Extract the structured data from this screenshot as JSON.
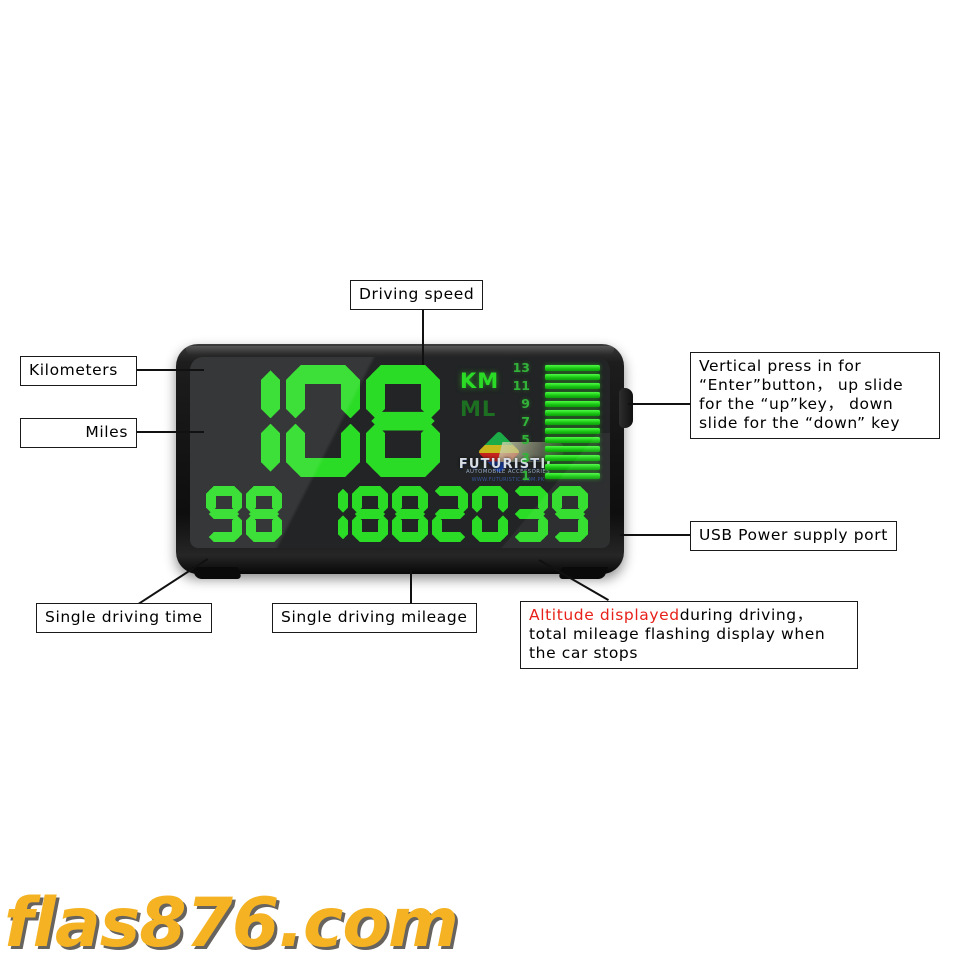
{
  "page": {
    "background": "#ffffff",
    "watermark": "flas876.com",
    "watermark_color": "#f5b324"
  },
  "device": {
    "type": "car-hud-head-up-display",
    "screen_bg": "#222425",
    "led_color": "#2bdc26",
    "led_dim_color": "#1d6f22",
    "speed": {
      "value": "108",
      "digits": [
        "1",
        "0",
        "8"
      ]
    },
    "units": {
      "km_label": "KM",
      "km_active": true,
      "ml_label": "ML",
      "ml_active": false
    },
    "gauge": {
      "scale_labels": [
        "13",
        "11",
        "9",
        "7",
        "5",
        "3",
        "1"
      ],
      "bar_count": 13,
      "bars_lit": 13
    },
    "bottom_row": {
      "driving_time": [
        "9",
        "8"
      ],
      "driving_mileage": [
        "1",
        "8",
        "8"
      ],
      "altitude": [
        "2",
        "0",
        "3",
        "9"
      ]
    },
    "brand": {
      "wordmark": "FUTURISTIC",
      "subwordmark": "AUTOMOBILE ACCESSORIES",
      "tagline": "WWW.FUTURISTIC.COM.PK"
    }
  },
  "callouts": {
    "driving_speed": "Driving speed",
    "kilometers": "Kilometers",
    "miles": "Miles",
    "side_button": {
      "line1": "Vertical press in for",
      "line2": "“Enter”button， up slide",
      "line3": "for the “up”key， down",
      "line4": "slide for the “down” key"
    },
    "usb_port": "USB Power supply port",
    "single_driving_time": "Single driving time",
    "single_driving_mileage": "Single driving mileage",
    "altitude": {
      "highlight": "Altitude displayed",
      "rest1": "during driving，",
      "line2": "total mileage flashing display when",
      "line3": "the car stops",
      "highlight_color": "#e8201a"
    }
  }
}
